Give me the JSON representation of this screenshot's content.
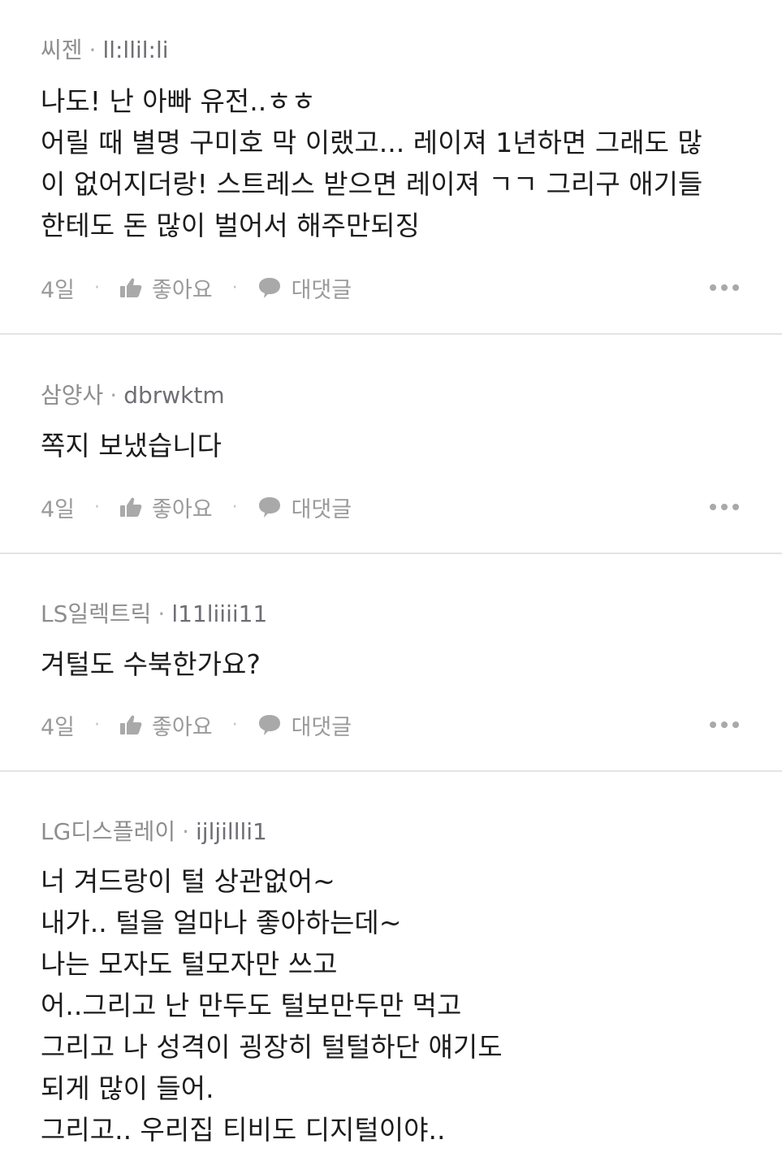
{
  "comments": [
    {
      "nickname": "씨젠",
      "username": "ll:llil:li",
      "lines": [
        "나도! 난 아빠 유전..ㅎㅎ",
        "어릴 때 별명 구미호 막 이랬고... 레이져 1년하면 그래도 많",
        "이 없어지더랑! 스트레스 받으면 레이져 ㄱㄱ 그리구 애기들",
        "한테도 돈 많이 벌어서 해주만되징"
      ],
      "time": "4일",
      "like_label": "좋아요",
      "reply_label": "대댓글"
    },
    {
      "nickname": "삼양사",
      "username": "dbrwktm",
      "lines": [
        "쪽지 보냈습니다"
      ],
      "time": "4일",
      "like_label": "좋아요",
      "reply_label": "대댓글"
    },
    {
      "nickname": "LS일렉트릭",
      "username": "l11liiii11",
      "lines": [
        "겨털도 수북한가요?"
      ],
      "time": "4일",
      "like_label": "좋아요",
      "reply_label": "대댓글"
    },
    {
      "nickname": "LG디스플레이",
      "username": "ijljillli1",
      "lines": [
        "너 겨드랑이 털 상관없어~",
        "내가.. 털을 얼마나 좋아하는데~",
        "나는 모자도 털모자만 쓰고",
        "어..그리고 난 만두도 털보만두만 먹고",
        "그리고 나 성격이 굉장히 털털하단 얘기도",
        "되게 많이 들어.",
        "그리고.. 우리집 티비도 디지털이야.."
      ]
    }
  ],
  "separator": "·",
  "colors": {
    "text": "#1c1c1c",
    "meta": "#8e8e8e",
    "divider": "#e4e4e4"
  },
  "icons": {
    "like": "thumbs-up-icon",
    "reply": "speech-bubble-icon",
    "more": "more-dots-icon"
  }
}
